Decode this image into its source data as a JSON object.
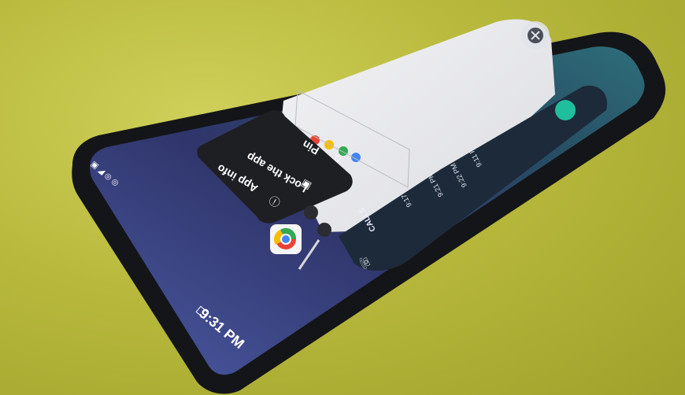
{
  "context_menu": {
    "items": [
      {
        "label": "Pin",
        "icon": "pin-icon"
      },
      {
        "label": "Lock the app",
        "icon": "lock-app-icon"
      },
      {
        "label": "App info",
        "icon": "info-icon"
      }
    ]
  },
  "status_bar": {
    "time": "9:31 PM"
  },
  "recents_app": {
    "name": "Chrome",
    "icon": "chrome-icon"
  },
  "side_app": {
    "tab_label": "CALLS",
    "times": [
      "9:17 PM",
      "9:21 PM",
      "9:22 PM",
      "9:11 PM"
    ],
    "icon": "phone-icon"
  },
  "colors": {
    "background": "#b8b93c",
    "phone_body": "#1a1c1f",
    "wallpaper": "#3d4a86",
    "menu_bg": "#1e1f22",
    "accent_green": "#1fbf9e"
  }
}
